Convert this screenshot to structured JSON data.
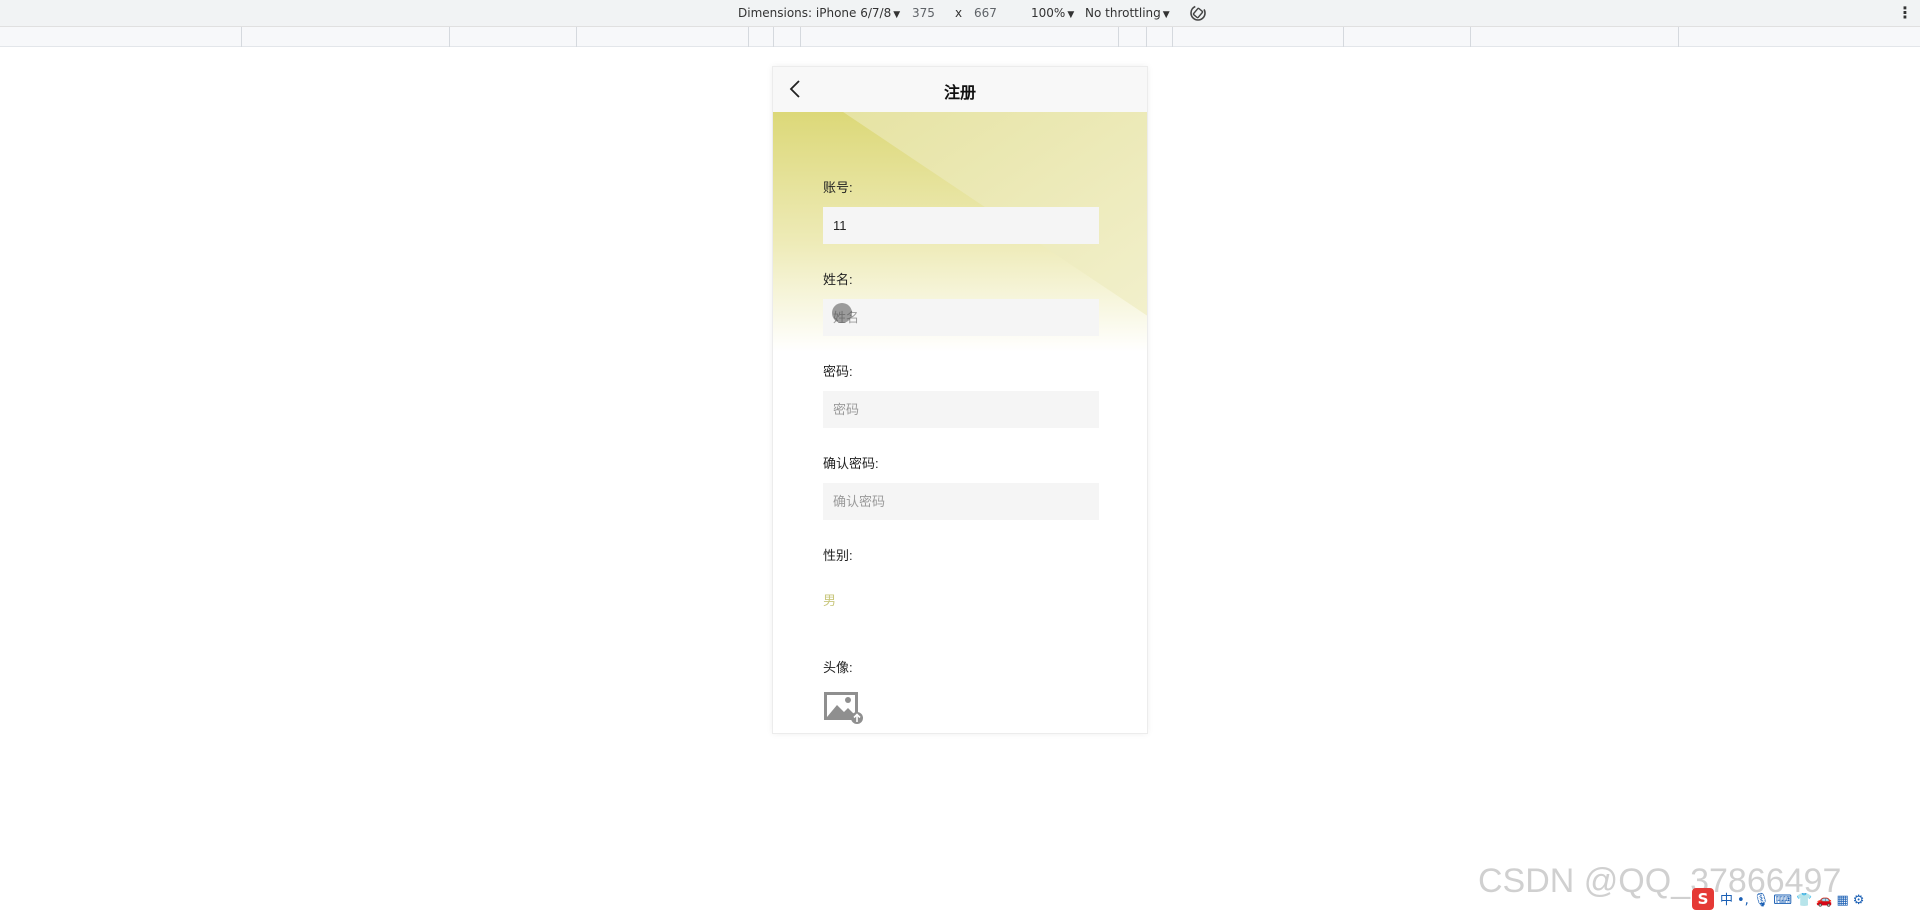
{
  "devtools": {
    "dimensions_label": "Dimensions: iPhone 6/7/8",
    "width": "375",
    "times": "x",
    "height": "667",
    "zoom": "100%",
    "throttling": "No throttling"
  },
  "navbar": {
    "title": "注册"
  },
  "form": {
    "account_label": "账号:",
    "account_value": "11",
    "name_label": "姓名:",
    "name_placeholder": "姓名",
    "password_label": "密码:",
    "password_placeholder": "密码",
    "confirm_label": "确认密码:",
    "confirm_placeholder": "确认密码",
    "gender_label": "性别:",
    "gender_value": "男",
    "avatar_label": "头像:"
  },
  "watermark": "CSDN @QQ_37866497",
  "tray": {
    "logo": "S",
    "ime": "中"
  },
  "colors": {
    "banner_primary": "#dcd878",
    "gender_accent": "#c9c77e"
  },
  "icons": [
    "back-arrow-icon",
    "rotate-icon",
    "more-vert-icon",
    "image-upload-icon"
  ]
}
